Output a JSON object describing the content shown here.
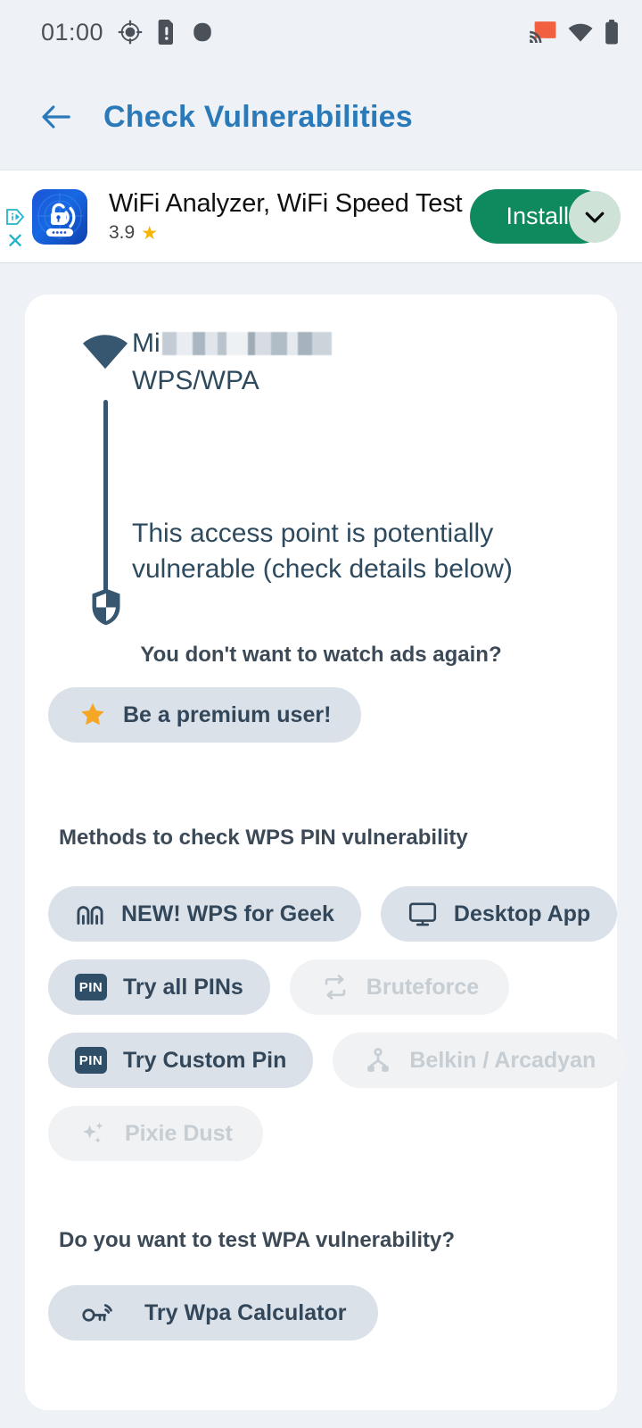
{
  "status_bar": {
    "time": "01:00",
    "icons_left": [
      "location-crosshair-icon",
      "sim-alert-icon",
      "dot-icon"
    ],
    "icons_right": [
      "cast-icon",
      "wifi-icon",
      "battery-icon"
    ],
    "cast_color": "#f2613f",
    "icon_color": "#4b5158"
  },
  "app_bar": {
    "back_label": "back-arrow",
    "title": "Check Vulnerabilities",
    "title_color": "#2a7ab9"
  },
  "ad": {
    "title": "WiFi Analyzer, WiFi Speed Test",
    "rating": "3.9",
    "star": "★",
    "install_label": "Install",
    "install_color": "#0f8a5f",
    "adchoices_label": "AdChoices",
    "close_label": "✕"
  },
  "access_point": {
    "ssid_prefix": "Mi",
    "ssid_redacted": true,
    "security": "WPS/WPA",
    "status_text": "This access point is potentially vulnerable (check details below)",
    "accent_color": "#37566f"
  },
  "premium": {
    "question": "You don't want to watch ads again?",
    "button_label": "Be a premium user!",
    "star_color": "#f5a623"
  },
  "methods": {
    "title": "Methods to check WPS PIN vulnerability",
    "rows": [
      [
        {
          "label": "NEW! WPS for Geek",
          "icon": "signal-peaks-icon",
          "enabled": true
        },
        {
          "label": "Desktop App",
          "icon": "monitor-icon",
          "enabled": true
        }
      ],
      [
        {
          "label": "Try all PINs",
          "icon": "pin-badge-icon",
          "enabled": true
        },
        {
          "label": "Bruteforce",
          "icon": "repeat-icon",
          "enabled": false
        }
      ],
      [
        {
          "label": "Try Custom Pin",
          "icon": "pin-badge-icon",
          "enabled": true
        },
        {
          "label": "Belkin / Arcadyan",
          "icon": "hierarchy-icon",
          "enabled": false
        }
      ],
      [
        {
          "label": "Pixie Dust",
          "icon": "sparkles-icon",
          "enabled": false
        }
      ]
    ]
  },
  "wpa": {
    "title": "Do you want to test WPA vulnerability?",
    "button_label": "Try Wpa Calculator",
    "button_icon": "key-wireless-icon"
  },
  "theme": {
    "page_background": "#eef2f7",
    "card_background": "#ffffff",
    "chip_enabled_bg": "#dbe1e8",
    "chip_disabled_bg": "#f0f2f4",
    "text_dark": "#33475b"
  }
}
